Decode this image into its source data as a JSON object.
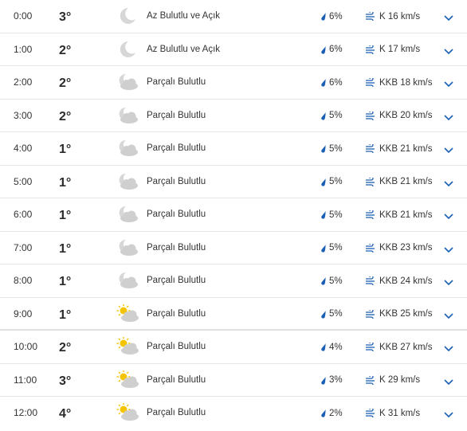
{
  "colors": {
    "accent": "#1a5fb4",
    "moon": "#d7d7d7",
    "cloud": "#cfcfcf",
    "sun": "#f4c400",
    "divider": "#e6e6e6"
  },
  "hours": [
    {
      "time": "0:00",
      "temp": "3°",
      "icon": "moon-icon",
      "condition": "Az Bulutlu ve Açık",
      "rain": "6%",
      "wind": "K 16 km/s"
    },
    {
      "time": "1:00",
      "temp": "2°",
      "icon": "moon-icon",
      "condition": "Az Bulutlu ve Açık",
      "rain": "6%",
      "wind": "K 17 km/s"
    },
    {
      "time": "2:00",
      "temp": "2°",
      "icon": "moon-cloud-icon",
      "condition": "Parçalı Bulutlu",
      "rain": "6%",
      "wind": "KKB 18 km/s"
    },
    {
      "time": "3:00",
      "temp": "2°",
      "icon": "moon-cloud-icon",
      "condition": "Parçalı Bulutlu",
      "rain": "5%",
      "wind": "KKB 20 km/s"
    },
    {
      "time": "4:00",
      "temp": "1°",
      "icon": "moon-cloud-icon",
      "condition": "Parçalı Bulutlu",
      "rain": "5%",
      "wind": "KKB 21 km/s"
    },
    {
      "time": "5:00",
      "temp": "1°",
      "icon": "moon-cloud-icon",
      "condition": "Parçalı Bulutlu",
      "rain": "5%",
      "wind": "KKB 21 km/s"
    },
    {
      "time": "6:00",
      "temp": "1°",
      "icon": "moon-cloud-icon",
      "condition": "Parçalı Bulutlu",
      "rain": "5%",
      "wind": "KKB 21 km/s"
    },
    {
      "time": "7:00",
      "temp": "1°",
      "icon": "moon-cloud-icon",
      "condition": "Parçalı Bulutlu",
      "rain": "5%",
      "wind": "KKB 23 km/s"
    },
    {
      "time": "8:00",
      "temp": "1°",
      "icon": "moon-cloud-icon",
      "condition": "Parçalı Bulutlu",
      "rain": "5%",
      "wind": "KKB 24 km/s"
    },
    {
      "time": "9:00",
      "temp": "1°",
      "icon": "sun-cloud-icon",
      "condition": "Parçalı Bulutlu",
      "rain": "5%",
      "wind": "KKB 25 km/s"
    },
    {
      "time": "10:00",
      "temp": "2°",
      "icon": "sun-cloud-icon",
      "condition": "Parçalı Bulutlu",
      "rain": "4%",
      "wind": "KKB 27 km/s"
    },
    {
      "time": "11:00",
      "temp": "3°",
      "icon": "sun-cloud-icon",
      "condition": "Parçalı Bulutlu",
      "rain": "3%",
      "wind": "K 29 km/s"
    },
    {
      "time": "12:00",
      "temp": "4°",
      "icon": "sun-cloud-icon",
      "condition": "Parçalı Bulutlu",
      "rain": "2%",
      "wind": "K 31 km/s"
    }
  ]
}
